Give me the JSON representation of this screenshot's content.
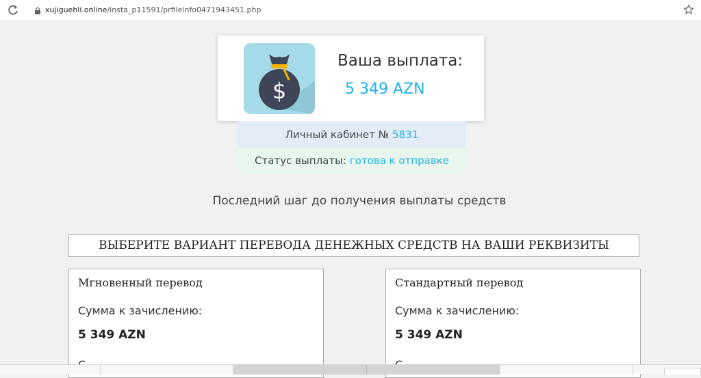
{
  "browser": {
    "url_host": "xujiguehli.online",
    "url_path": "/insta_p11591/prfileinfo0471943451.php"
  },
  "payout_card": {
    "label": "Ваша выплата:",
    "amount": "5 349 AZN",
    "icon": "money-bag-icon"
  },
  "account": {
    "label": "Личный кабинет №",
    "number": "5831"
  },
  "status": {
    "label": "Статус выплаты:",
    "value": "готова к отправке"
  },
  "last_step": "Последний шаг до получения выплаты средств",
  "choose_transfer": "ВЫБЕРИТЕ ВАРИАНТ ПЕРЕВОДА ДЕНЕЖНЫХ СРЕДСТВ НА ВАШИ РЕКВИЗИТЫ",
  "options": [
    {
      "title": "Мгновенный перевод",
      "sum_label": "Сумма к зачислению:",
      "sum": "5 349 AZN",
      "cut_text": "С"
    },
    {
      "title": "Стандартный перевод",
      "sum_label": "Сумма к зачислению:",
      "sum": "5 349 AZN",
      "cut_text": "С"
    }
  ],
  "colors": {
    "accent": "#1fb3e6",
    "bag_background": "#a6dae8",
    "account_background": "#e4edf7",
    "status_background": "#e8f6ee"
  }
}
